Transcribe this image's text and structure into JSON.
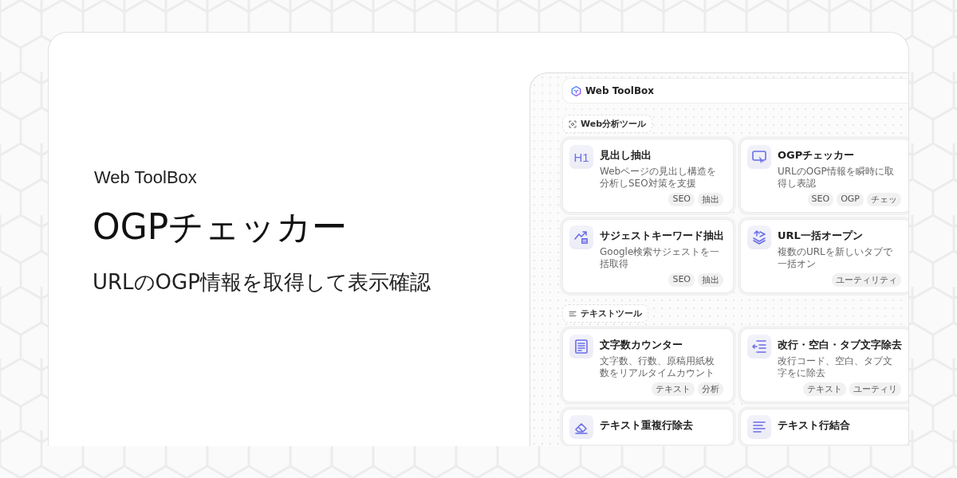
{
  "hero": {
    "brand": "Web ToolBox",
    "title": "OGPチェッカー",
    "subtitle": "URLのOGP情報を取得して表示確認"
  },
  "app": {
    "logo_text": "Web ToolBox",
    "sections": [
      {
        "label": "Web分析ツール",
        "kind": "scan",
        "tools": [
          {
            "kind": "heading",
            "icon_text": "H1",
            "title": "見出し抽出",
            "description": "Webページの見出し構造を分析しSEO対策を支援",
            "tags": [
              "SEO",
              "抽出"
            ]
          },
          {
            "kind": "screen",
            "title": "OGPチェッカー",
            "description": "URLのOGP情報を瞬時に取得し表認",
            "tags": [
              "SEO",
              "OGP",
              "チェッ"
            ]
          },
          {
            "kind": "trend",
            "title": "サジェストキーワード抽出",
            "description": "Google検索サジェストを一括取得",
            "tags": [
              "SEO",
              "抽出"
            ]
          },
          {
            "kind": "stack",
            "title": "URL一括オープン",
            "description": "複数のURLを新しいタブで一括オン",
            "tags": [
              "ユーティリティ"
            ]
          }
        ]
      },
      {
        "label": "テキストツール",
        "kind": "lines",
        "tools": [
          {
            "kind": "document",
            "title": "文字数カウンター",
            "description": "文字数、行数、原稿用紙枚数をリアルタイムカウント",
            "tags": [
              "テキスト",
              "分析"
            ]
          },
          {
            "kind": "indent",
            "title": "改行・空白・タブ文字除去",
            "description": "改行コード、空白、タブ文字をに除去",
            "tags": [
              "テキスト",
              "ユーティリ"
            ]
          },
          {
            "kind": "eraser",
            "title": "テキスト重複行除去"
          },
          {
            "kind": "lines",
            "title": "テキスト行結合"
          }
        ]
      }
    ]
  }
}
